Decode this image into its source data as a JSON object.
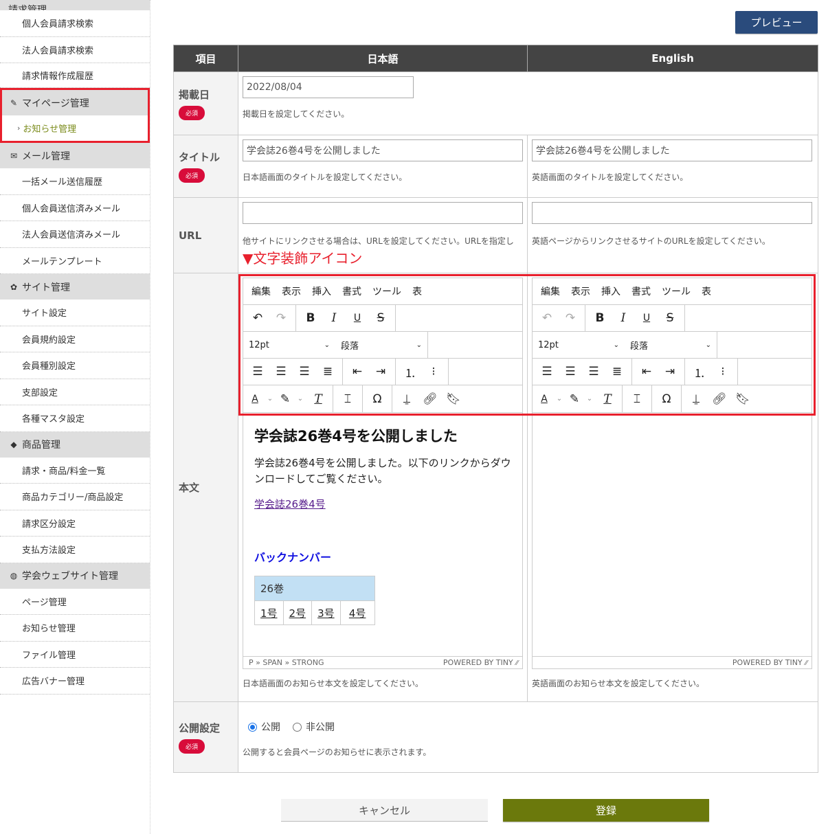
{
  "sidebar": {
    "top_section_cut": "請求管理",
    "billing_items": [
      "個人会員請求検索",
      "法人会員請求検索",
      "請求情報作成履歴"
    ],
    "mypage": {
      "label": "マイページ管理",
      "icon": "pencil-icon",
      "items": [
        "お知らせ管理"
      ]
    },
    "mail": {
      "label": "メール管理",
      "icon": "envelope-icon",
      "items": [
        "一括メール送信履歴",
        "個人会員送信済みメール",
        "法人会員送信済みメール",
        "メールテンプレート"
      ]
    },
    "site": {
      "label": "サイト管理",
      "icon": "gear-icon",
      "items": [
        "サイト設定",
        "会員規約設定",
        "会員種別設定",
        "支部設定",
        "各種マスタ設定"
      ]
    },
    "product": {
      "label": "商品管理",
      "icon": "tag-icon",
      "items": [
        "請求・商品/料金一覧",
        "商品カテゴリー/商品設定",
        "請求区分設定",
        "支払方法設定"
      ]
    },
    "website": {
      "label": "学会ウェブサイト管理",
      "icon": "globe-icon",
      "items": [
        "ページ管理",
        "お知らせ管理",
        "ファイル管理",
        "広告バナー管理"
      ]
    }
  },
  "toolbar": {
    "preview_label": "プレビュー"
  },
  "table": {
    "headers": [
      "項目",
      "日本語",
      "English"
    ],
    "required_badge": "必須",
    "date": {
      "label": "掲載日",
      "value": "2022/08/04",
      "help": "掲載日を設定してください。"
    },
    "title": {
      "label": "タイトル",
      "ja_value": "学会誌26巻4号を公開しました",
      "en_value": "学会誌26巻4号を公開しました",
      "ja_help": "日本語画面のタイトルを設定してください。",
      "en_help": "英語画面のタイトルを設定してください。"
    },
    "url": {
      "label": "URL",
      "ja_value": "",
      "en_value": "",
      "ja_help": "他サイトにリンクさせる場合は、URLを設定してください。URLを指定し",
      "en_help": "英語ページからリンクさせるサイトのURLを設定してください。",
      "annotation": "▼文字装飾アイコン"
    },
    "body": {
      "label": "本文",
      "ja_help": "日本語画面のお知らせ本文を設定してください。",
      "en_help": "英語画面のお知らせ本文を設定してください。"
    },
    "publish": {
      "label": "公開設定",
      "options": [
        "公開",
        "非公開"
      ],
      "selected": "公開",
      "help": "公開すると会員ページのお知らせに表示されます。"
    }
  },
  "editor": {
    "menu": [
      "編集",
      "表示",
      "挿入",
      "書式",
      "ツール",
      "表"
    ],
    "font_size": "12pt",
    "block_format": "段落",
    "powered_by": "POWERED BY TINY",
    "ja_path": "P » SPAN » STRONG",
    "ja_content": {
      "heading": "学会誌26巻4号を公開しました",
      "paragraph": "学会誌26巻4号を公開しました。以下のリンクからダウンロードしてご覧ください。",
      "link": "学会誌26巻4号",
      "backnumber": "バックナンバー",
      "volume": "26巻",
      "issues": [
        "1号",
        "2号",
        "3号",
        "4号"
      ]
    }
  },
  "buttons": {
    "cancel": "キャンセル",
    "submit": "登録"
  },
  "colors": {
    "accent_red": "#e8202d",
    "required": "#d80c3a",
    "preview": "#2a4b7c",
    "submit": "#6b790c",
    "active_nav": "#7a8b1a",
    "header": "#444444"
  }
}
